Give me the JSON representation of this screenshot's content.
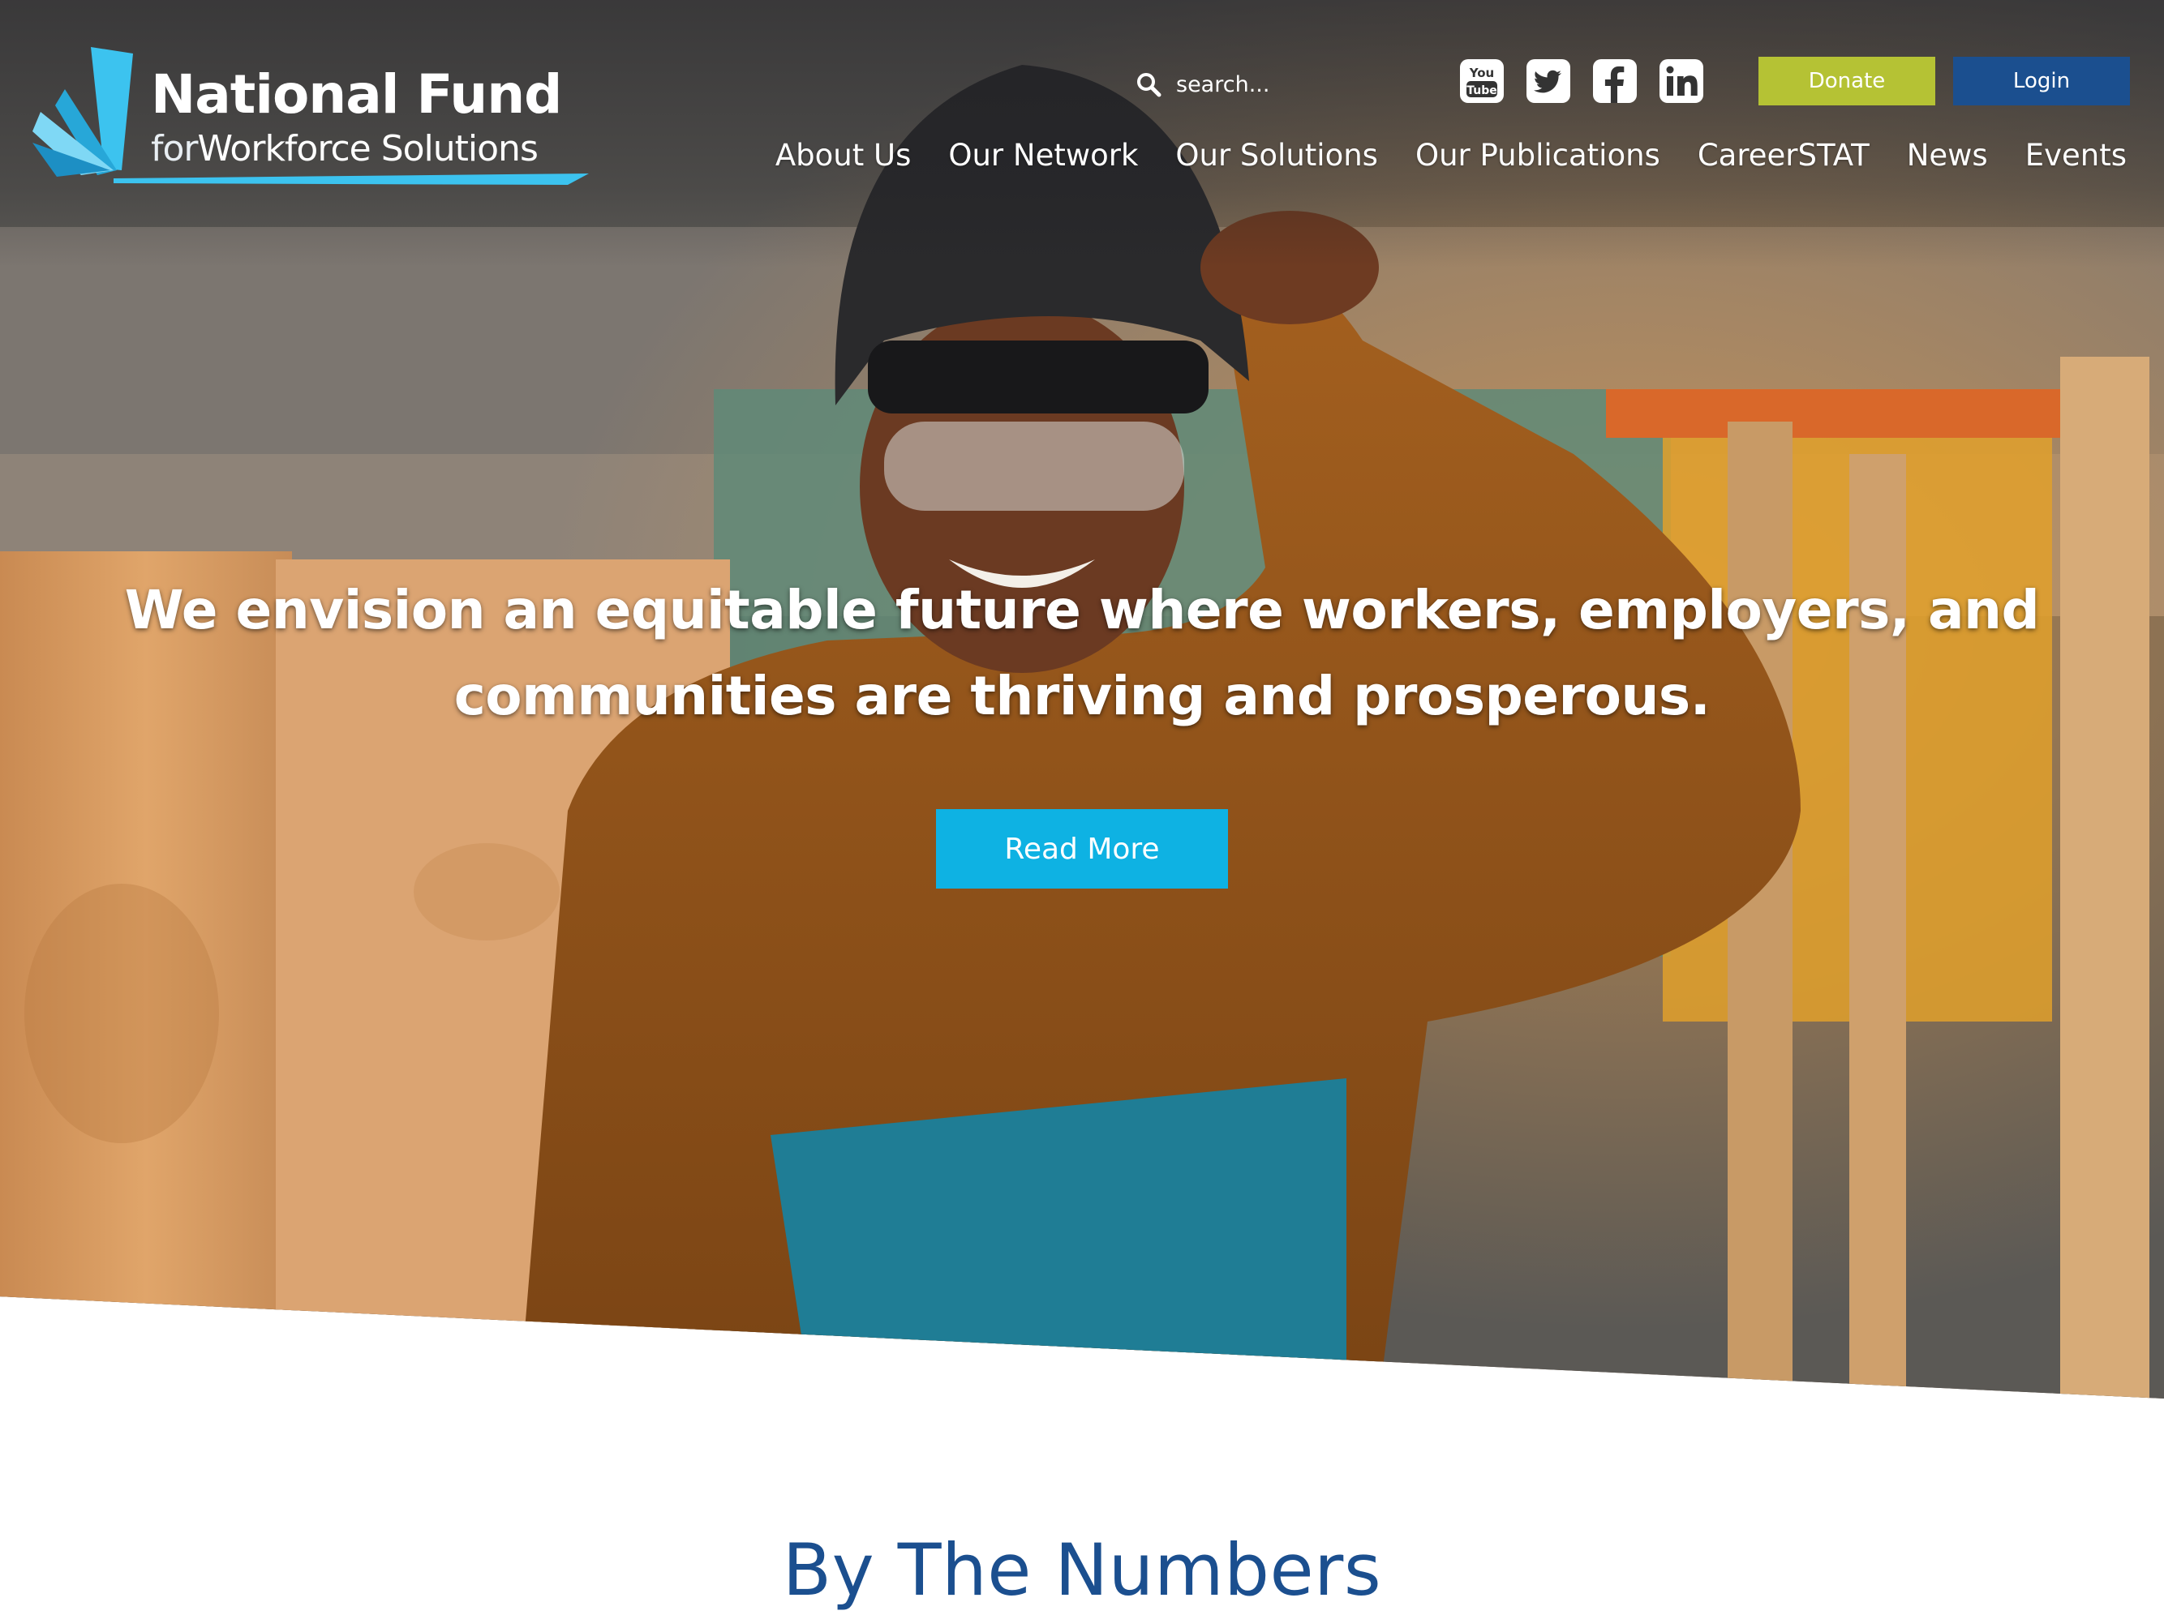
{
  "header": {
    "logo": {
      "line1": "National Fund",
      "line2_for": "for",
      "line2_rest": "Workforce Solutions"
    },
    "search": {
      "placeholder": "search...",
      "icon": "search-icon"
    },
    "social": [
      {
        "name": "YouTube",
        "icon": "youtube-icon"
      },
      {
        "name": "Twitter",
        "icon": "twitter-icon"
      },
      {
        "name": "Facebook",
        "icon": "facebook-icon"
      },
      {
        "name": "LinkedIn",
        "icon": "linkedin-icon"
      }
    ],
    "donate_label": "Donate",
    "login_label": "Login",
    "nav": [
      "About Us",
      "Our Network",
      "Our Solutions",
      "Our Publications",
      "CareerSTAT",
      "News",
      "Events"
    ]
  },
  "hero": {
    "headline_line1": "We envision an equitable future where workers, employers, and",
    "headline_line2": "communities are thriving and prosperous.",
    "read_more_label": "Read More"
  },
  "numbers": {
    "title": "By The Numbers"
  },
  "colors": {
    "donate": "#b5c234",
    "login": "#1b4f8f",
    "read_more": "#0eb2e3",
    "section_title": "#1b4f8f",
    "logo_accent": "#3cc3ef"
  }
}
